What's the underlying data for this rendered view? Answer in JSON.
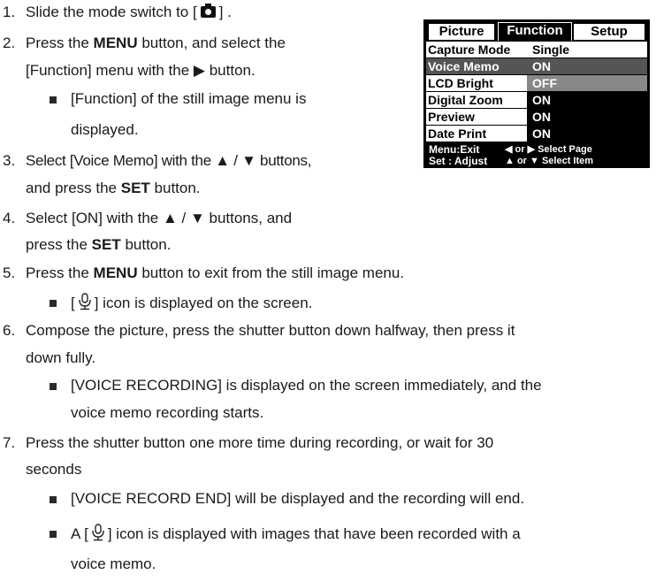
{
  "steps": [
    {
      "num": "1.",
      "pre": "Slide the mode switch to [",
      "post": "] ."
    },
    {
      "num": "2.",
      "line1_a": "Press the ",
      "line1_b": "MENU",
      "line1_c": " button, and select the",
      "line2": "[Function] menu with the ▶ button."
    },
    {
      "bullet1_l1": "[Function] of the still image menu is",
      "bullet1_l2": "displayed."
    },
    {
      "num": "3.",
      "line1": "Select [Voice Memo] with the ▲ / ▼ buttons,",
      "line2_a": "and press the ",
      "line2_b": "SET",
      "line2_c": " button."
    },
    {
      "num": "4.",
      "line1": "Select [ON] with the ▲ / ▼ buttons, and",
      "line2_a": "press the ",
      "line2_b": "SET",
      "line2_c": " button."
    },
    {
      "num": "5.",
      "a": "Press the ",
      "b": "MENU",
      "c": " button to exit from the still image menu."
    },
    {
      "bullet_a": "[",
      "bullet_b": "] icon is displayed on the screen."
    },
    {
      "num": "6.",
      "line1": "Compose the picture, press the shutter button down halfway, then press it",
      "line2": "down fully."
    },
    {
      "bullet_l1": "[VOICE RECORDING] is displayed on the screen immediately, and the",
      "bullet_l2": "voice memo recording starts."
    },
    {
      "num": "7.",
      "line1": "Press the shutter button one more time during recording, or wait for 30",
      "line2": "seconds"
    },
    {
      "bullet": "[VOICE RECORD END] will be displayed and the recording will end."
    },
    {
      "bullet_a": "A [",
      "bullet_b": "] icon is displayed with images that have been recorded with a",
      "bullet_l2": "voice memo."
    }
  ],
  "lcd": {
    "tabs": [
      "Picture",
      "Function",
      "Setup"
    ],
    "rows": [
      {
        "label": "Capture Mode",
        "value": "Single"
      },
      {
        "label": "Voice Memo",
        "value": "ON"
      },
      {
        "label": "LCD Bright",
        "value": "OFF"
      },
      {
        "label": "Digital Zoom",
        "value": "ON"
      },
      {
        "label": "Preview",
        "value": "ON"
      },
      {
        "label": "Date Print",
        "value": "ON"
      }
    ],
    "help1a": "Menu:Exit",
    "help1b": "◀ or ▶ Select Page",
    "help2a": "Set : Adjust",
    "help2b": "▲ or ▼ Select Item"
  }
}
